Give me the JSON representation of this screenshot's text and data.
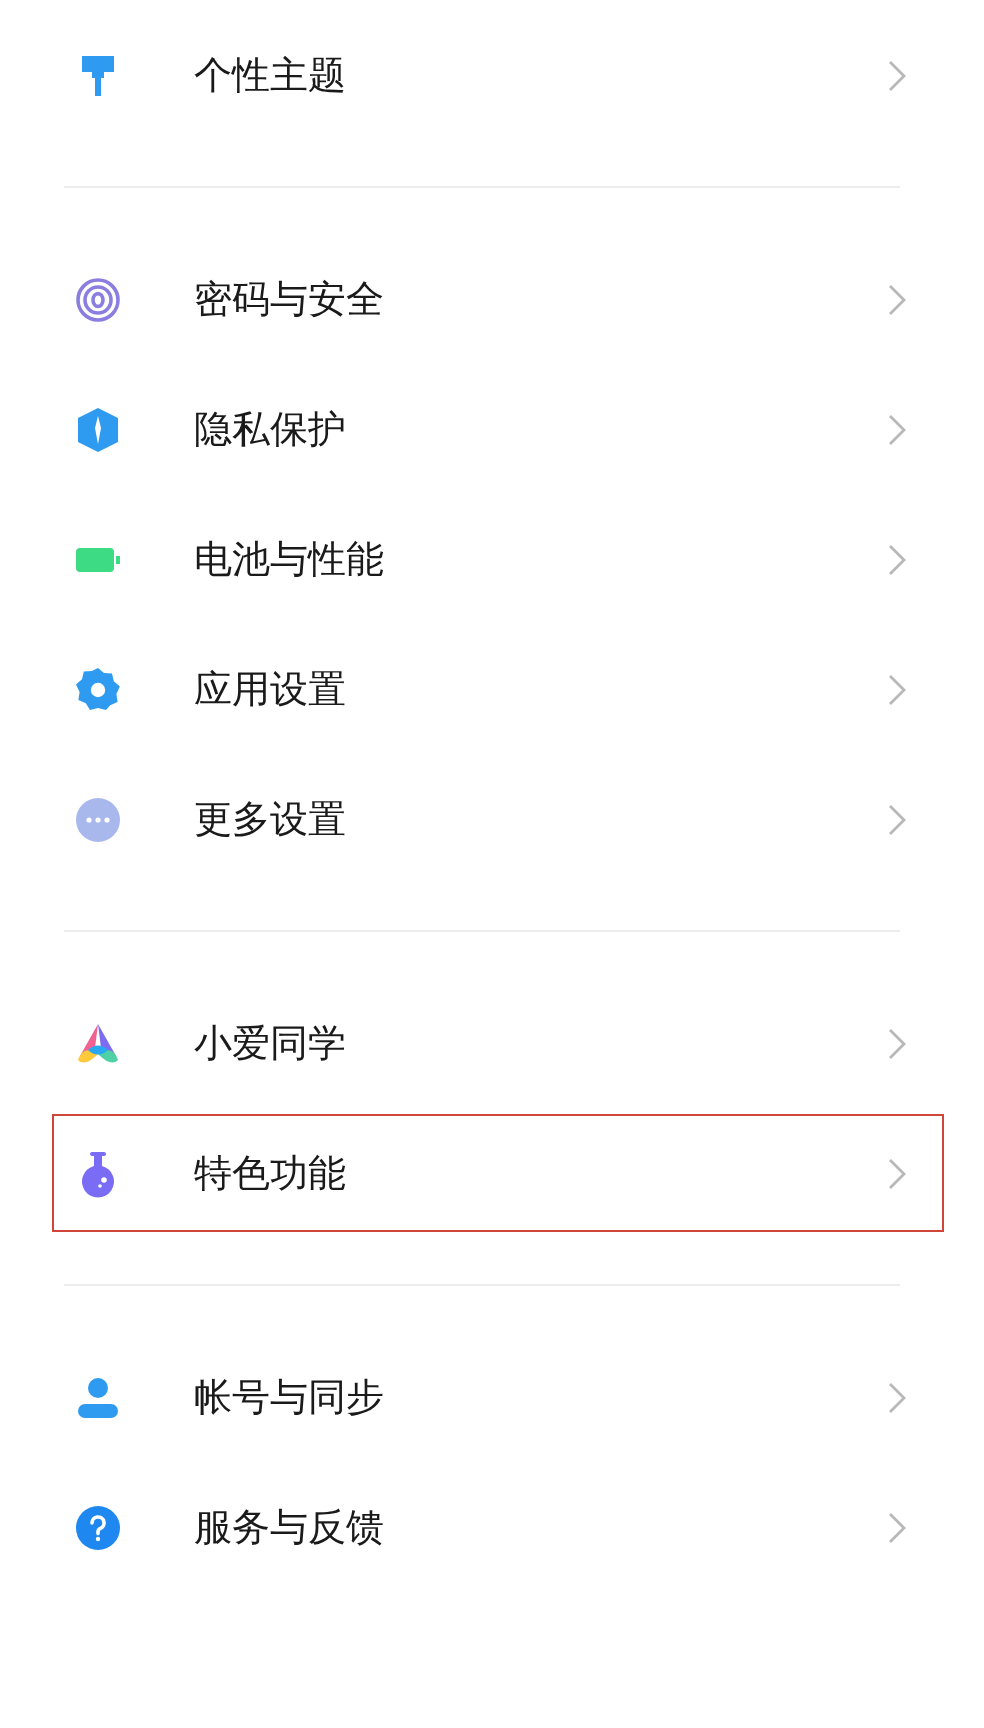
{
  "groups": [
    {
      "items": [
        {
          "label": "个性主题",
          "highlighted": false
        }
      ]
    },
    {
      "items": [
        {
          "label": "密码与安全",
          "highlighted": false
        },
        {
          "label": "隐私保护",
          "highlighted": false
        },
        {
          "label": "电池与性能",
          "highlighted": false
        },
        {
          "label": "应用设置",
          "highlighted": false
        },
        {
          "label": "更多设置",
          "highlighted": false
        }
      ]
    },
    {
      "items": [
        {
          "label": "小爱同学",
          "highlighted": false
        },
        {
          "label": "特色功能",
          "highlighted": true
        }
      ]
    },
    {
      "items": [
        {
          "label": "帐号与同步",
          "highlighted": false
        },
        {
          "label": "服务与反馈",
          "highlighted": false
        }
      ]
    }
  ]
}
